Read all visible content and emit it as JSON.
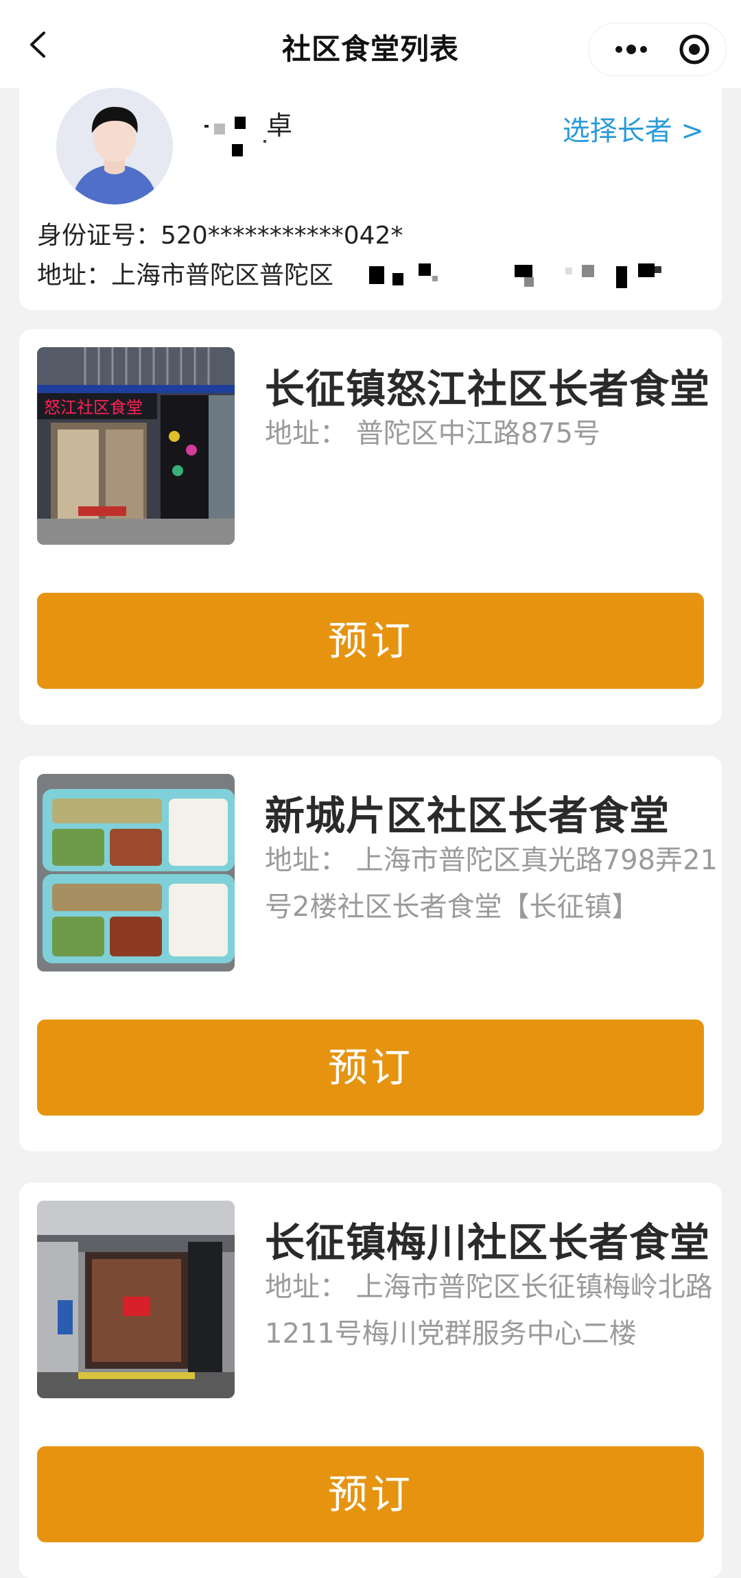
{
  "nav": {
    "title": "社区食堂列表"
  },
  "profile": {
    "name_visible": "卓",
    "select_label": "选择长者 >",
    "id_label": "身份证号：",
    "id_value": "520***********042*",
    "address_label": "地址：",
    "address_value": "上海市普陀区普陀区"
  },
  "canteens": [
    {
      "name": "长征镇怒江社区长者食堂",
      "address": "地址：  普陀区中江路875号",
      "book_label": "预订",
      "sign_text": "怒江社区食堂"
    },
    {
      "name": "新城片区社区长者食堂",
      "address": "地址：  上海市普陀区真光路798弄21号2楼社区长者食堂【长征镇】",
      "book_label": "预订"
    },
    {
      "name": "长征镇梅川社区长者食堂",
      "address": "地址：  上海市普陀区长征镇梅岭北路1211号梅川党群服务中心二楼",
      "book_label": "预订"
    }
  ],
  "colors": {
    "accent": "#e69410",
    "link": "#2b9bd8",
    "background": "#f2f2f2"
  },
  "icons": [
    "back-chevron-icon",
    "more-dots-icon",
    "target-icon"
  ]
}
